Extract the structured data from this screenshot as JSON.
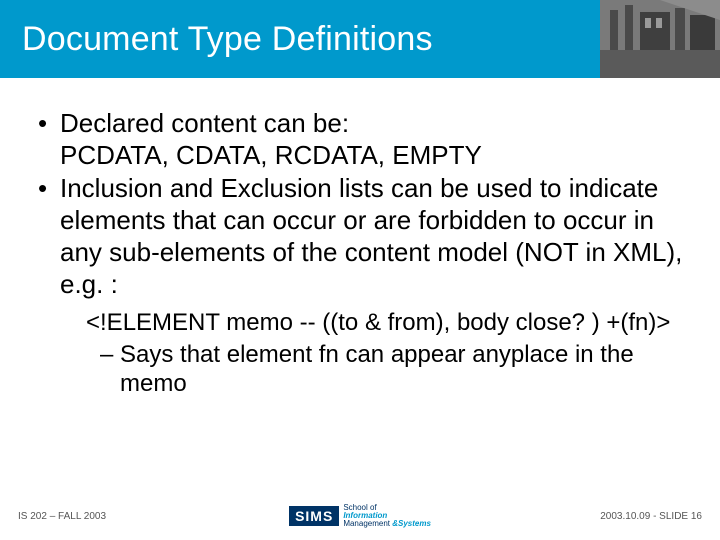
{
  "header": {
    "title": "Document Type Definitions"
  },
  "body": {
    "bullets": [
      {
        "line1": "Declared content can be:",
        "line2": "PCDATA, CDATA, RCDATA, EMPTY"
      },
      {
        "text": "Inclusion and Exclusion lists can be used to indicate elements that can occur or are forbidden to occur in any sub-elements of the content model (NOT in XML), e.g. :"
      }
    ],
    "sub": {
      "code": "<!ELEMENT memo -- ((to & from), body close? ) +(fn)>",
      "explain": "Says that element fn can appear anyplace in the memo"
    }
  },
  "footer": {
    "left": "IS 202 – FALL 2003",
    "logo": {
      "acronym": "SIMS",
      "line1": "School of",
      "line2a": "",
      "line2b": "Information",
      "line3a": "Management ",
      "line3b": "&Systems"
    },
    "right": "2003.10.09 - SLIDE 16"
  }
}
